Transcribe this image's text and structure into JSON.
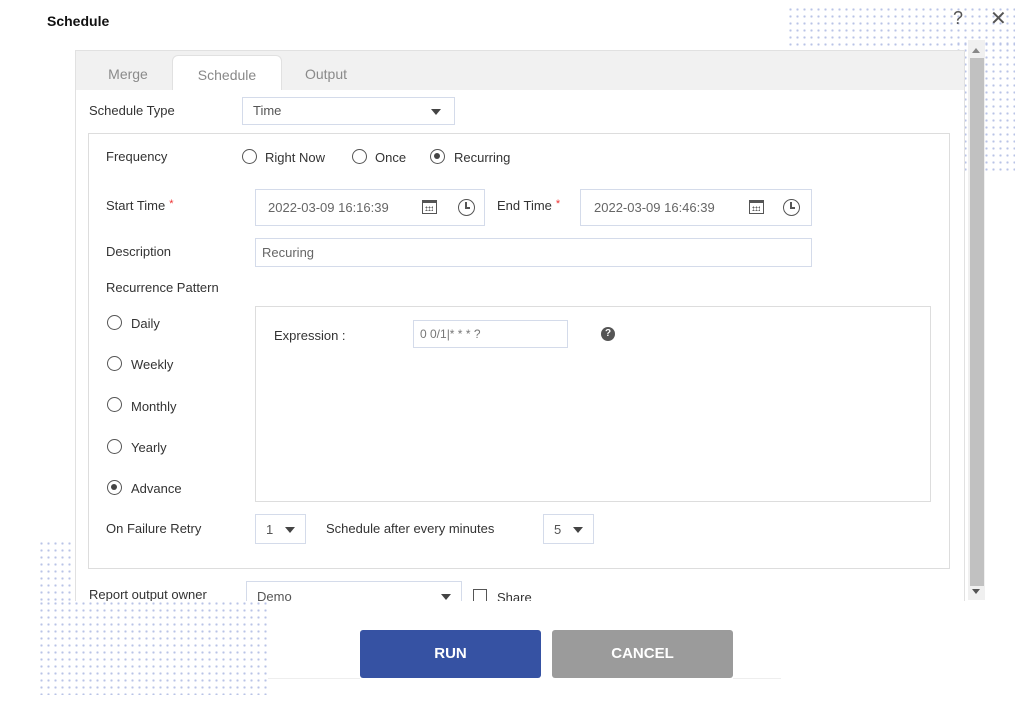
{
  "dialog": {
    "title": "Schedule",
    "help_glyph": "?",
    "close_glyph": "✕"
  },
  "tabs": [
    {
      "label": "Merge",
      "active": false
    },
    {
      "label": "Schedule",
      "active": true
    },
    {
      "label": "Output",
      "active": false
    }
  ],
  "schedule_type": {
    "label": "Schedule Type",
    "value": "Time"
  },
  "frequency": {
    "label": "Frequency",
    "options": [
      {
        "label": "Right Now",
        "checked": false
      },
      {
        "label": "Once",
        "checked": false
      },
      {
        "label": "Recurring",
        "checked": true
      }
    ]
  },
  "start_time": {
    "label": "Start Time",
    "required_mark": "*",
    "value": "2022-03-09 16:16:39"
  },
  "end_time": {
    "label": "End Time",
    "required_mark": "*",
    "value": "2022-03-09 16:46:39"
  },
  "description": {
    "label": "Description",
    "value": "Recuring"
  },
  "recurrence": {
    "label": "Recurrence Pattern",
    "options": [
      {
        "label": "Daily",
        "checked": false
      },
      {
        "label": "Weekly",
        "checked": false
      },
      {
        "label": "Monthly",
        "checked": false
      },
      {
        "label": "Yearly",
        "checked": false
      },
      {
        "label": "Advance",
        "checked": true
      }
    ],
    "expression_label": "Expression :",
    "expression_value": "0 0/1|* * * ?",
    "expression_help_glyph": "?"
  },
  "retry": {
    "label": "On Failure Retry",
    "value": "1",
    "interval_label": "Schedule after every minutes",
    "interval_value": "5"
  },
  "owner": {
    "label": "Report output owner",
    "value": "Demo",
    "share_label": "Share",
    "share_checked": false
  },
  "buttons": {
    "run": "RUN",
    "cancel": "CANCEL"
  },
  "colors": {
    "run": "#3652a3",
    "cancel": "#9b9b9b",
    "required": "#ee3333"
  }
}
